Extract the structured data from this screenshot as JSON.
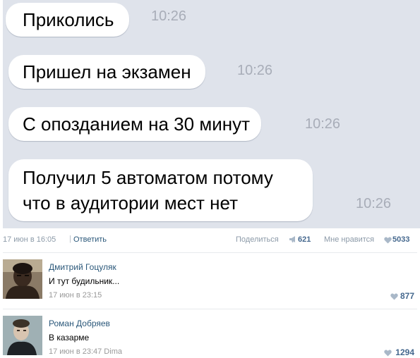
{
  "chat": {
    "messages": [
      {
        "text": "Приколись",
        "time": "10:26"
      },
      {
        "text": "Пришел на экзамен",
        "time": "10:26"
      },
      {
        "text": "С опозданием на 30 минут",
        "time": "10:26"
      },
      {
        "text_line1": "Получил 5 автоматом потому",
        "text_line2": "что в аудитории мест нет",
        "time": "10:26"
      }
    ]
  },
  "post": {
    "date": "17 июн в 16:05",
    "separator": "|",
    "reply_label": "Ответить",
    "share_label": "Поделиться",
    "share_count": "621",
    "like_label": "Мне нравится",
    "like_count": "5033"
  },
  "comments": [
    {
      "author": "Дмитрий Гоцуляк",
      "text": "И тут будильник...",
      "date": "17 июн в 23:15",
      "likes": "877"
    },
    {
      "author": "Роман Добряев",
      "text": "В казарме",
      "date": "17 июн в 23:47 Dima",
      "likes": "1294"
    }
  ],
  "icons": {
    "share": "megaphone-icon",
    "like": "heart-icon"
  },
  "colors": {
    "chat_bg": "#dfe3eb",
    "link": "#2b587a",
    "accent": "#45688e",
    "muted": "#8c9aa8"
  }
}
